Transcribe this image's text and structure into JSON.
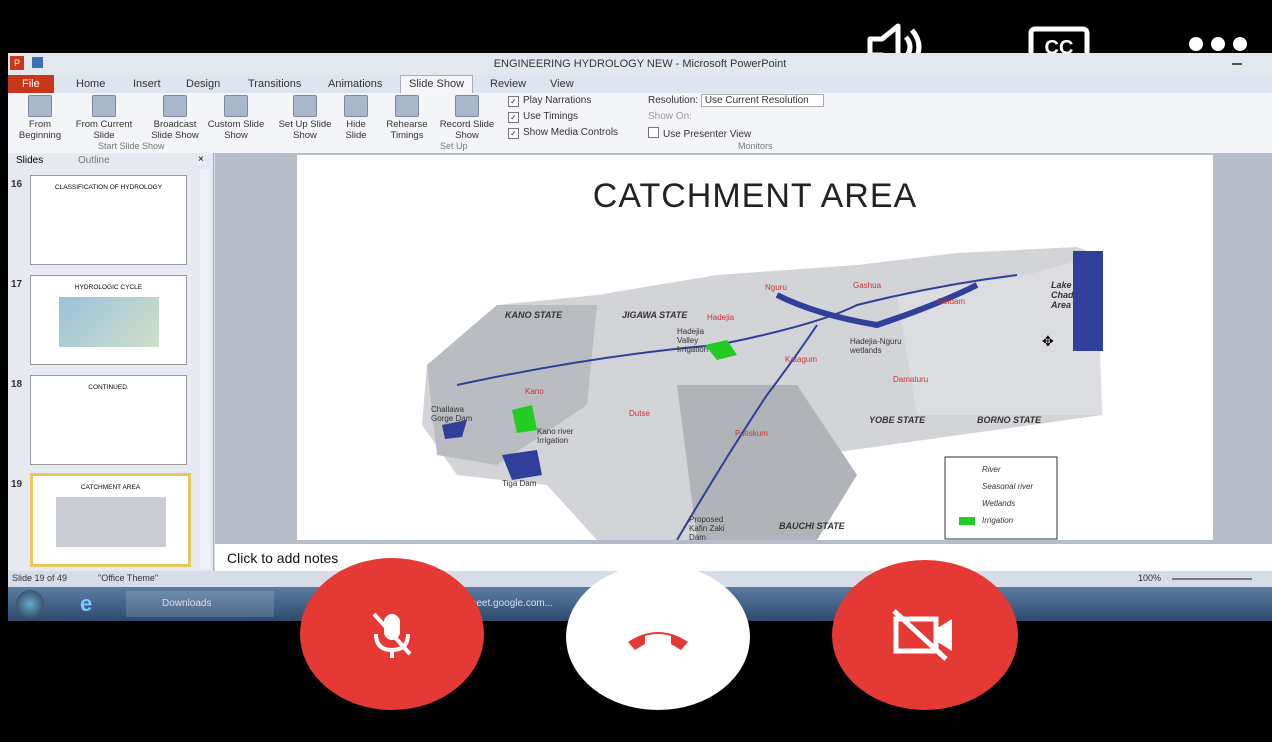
{
  "call": {
    "icons": [
      "speaker-icon",
      "closed-captions-icon",
      "more-options-icon",
      "mic-off-icon",
      "end-call-icon",
      "camera-off-icon"
    ],
    "colors": {
      "mute": "#e53935",
      "end": "#ffffff",
      "end_icon": "#e53935",
      "camera": "#e53935"
    }
  },
  "ppt": {
    "window_title": "ENGINEERING HYDROLOGY NEW - Microsoft PowerPoint",
    "tabs": [
      "File",
      "Home",
      "Insert",
      "Design",
      "Transitions",
      "Animations",
      "Slide Show",
      "Review",
      "View"
    ],
    "active_tab": "Slide Show",
    "ribbon": {
      "from_beginning": "From Beginning",
      "from_current": "From Current Slide",
      "broadcast": "Broadcast Slide Show",
      "custom": "Custom Slide Show",
      "group_start": "Start Slide Show",
      "setup": "Set Up Slide Show",
      "hide": "Hide Slide",
      "rehearse": "Rehearse Timings",
      "record": "Record Slide Show",
      "group_setup": "Set Up",
      "play_narrations": "Play Narrations",
      "use_timings": "Use Timings",
      "show_media": "Show Media Controls",
      "resolution": "Resolution:",
      "resolution_value": "Use Current Resolution",
      "show_on": "Show On:",
      "presenter_view": "Use Presenter View",
      "group_monitors": "Monitors"
    },
    "pane_tabs": [
      "Slides",
      "Outline"
    ],
    "thumbnails": [
      {
        "num": "16",
        "title": "CLASSIFICATION OF HYDROLOGY"
      },
      {
        "num": "17",
        "title": "HYDROLOGIC CYCLE"
      },
      {
        "num": "18",
        "title": "CONTINUED."
      },
      {
        "num": "19",
        "title": "CATCHMENT AREA"
      }
    ],
    "slide": {
      "title": "CATCHMENT AREA",
      "map_labels": {
        "kano_state": "KANO STATE",
        "jigawa_state": "JIGAWA STATE",
        "yobe_state": "YOBE STATE",
        "borno_state": "BORNO STATE",
        "bauchi_state": "BAUCHI STATE",
        "lake_chad": "Lake Chad Area",
        "kano": "Kano",
        "hadejia_valley": "Hadejia Valley Irrigation",
        "kano_irrigation": "Kano river Irrigation",
        "challawa": "Challawa Gorge Dam",
        "tiga": "Tiga Dam",
        "kafin_zaki": "Proposed Kafin Zaki Dam",
        "wetlands": "Hadejia-Nguru wetlands",
        "nguru": "Nguru",
        "hadejia": "Hadejia",
        "katagum": "Katagum",
        "dutse": "Dutse",
        "gashua": "Gashua",
        "geidam": "Geidam",
        "damaturu": "Damaturu",
        "potiskum": "Potiskum"
      },
      "legend": [
        "River",
        "Seasonal river",
        "Wetlands",
        "Irrigation"
      ]
    },
    "notes_placeholder": "Click to add notes",
    "status": {
      "slide": "Slide 19 of 49",
      "theme": "\"Office Theme\"",
      "zoom": "100%"
    },
    "taskbar": {
      "item1": "Downloads",
      "item2": "meet.google.com..."
    }
  }
}
